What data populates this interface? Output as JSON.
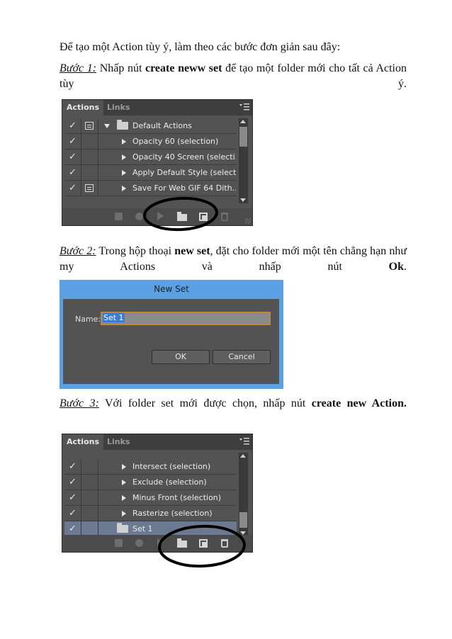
{
  "intro": "Để tạo một Action tùy ý, làm theo các bước đơn giản sau đây:",
  "step1": {
    "label": "Bước 1:",
    "text_a": " Nhấp nút ",
    "bold": "create neww set",
    "text_b": " để tạo một folder mới cho tất cả Action tùy ý."
  },
  "panel1": {
    "tab_active": "Actions",
    "tab_inactive": "Links",
    "rows": [
      {
        "label": "Default Actions"
      },
      {
        "label": "Opacity 60 (selection)"
      },
      {
        "label": "Opacity 40 Screen (selecti..."
      },
      {
        "label": "Apply Default Style (select..."
      },
      {
        "label": "Save For Web GIF 64 Dith..."
      }
    ]
  },
  "step2": {
    "label": "Bước 2:",
    "text_a": " Trong hộp thoại ",
    "bold1": "new set",
    "text_b": ", đặt cho folder mới một tên chẳng hạn như my Actions và nhấp nút ",
    "bold2": "Ok",
    "text_c": "."
  },
  "dialog": {
    "title": "New Set",
    "name_label": "Name:",
    "name_value": "Set 1",
    "ok_label": "OK",
    "cancel_label": "Cancel"
  },
  "step3": {
    "label": "Bước 3:",
    "text_a": " Với folder set mới được chọn, nhấp nút ",
    "bold": "create new Action."
  },
  "panel2": {
    "tab_active": "Actions",
    "tab_inactive": "Links",
    "rows": [
      {
        "label": "Intersect (selection)"
      },
      {
        "label": "Exclude (selection)"
      },
      {
        "label": "Minus Front (selection)"
      },
      {
        "label": "Rasterize (selection)"
      },
      {
        "label": "Set 1"
      }
    ]
  },
  "colors": {
    "panel_bg": "#535353",
    "dialog_frame": "#5aa0e3",
    "selected_row": "#6b7a90"
  }
}
